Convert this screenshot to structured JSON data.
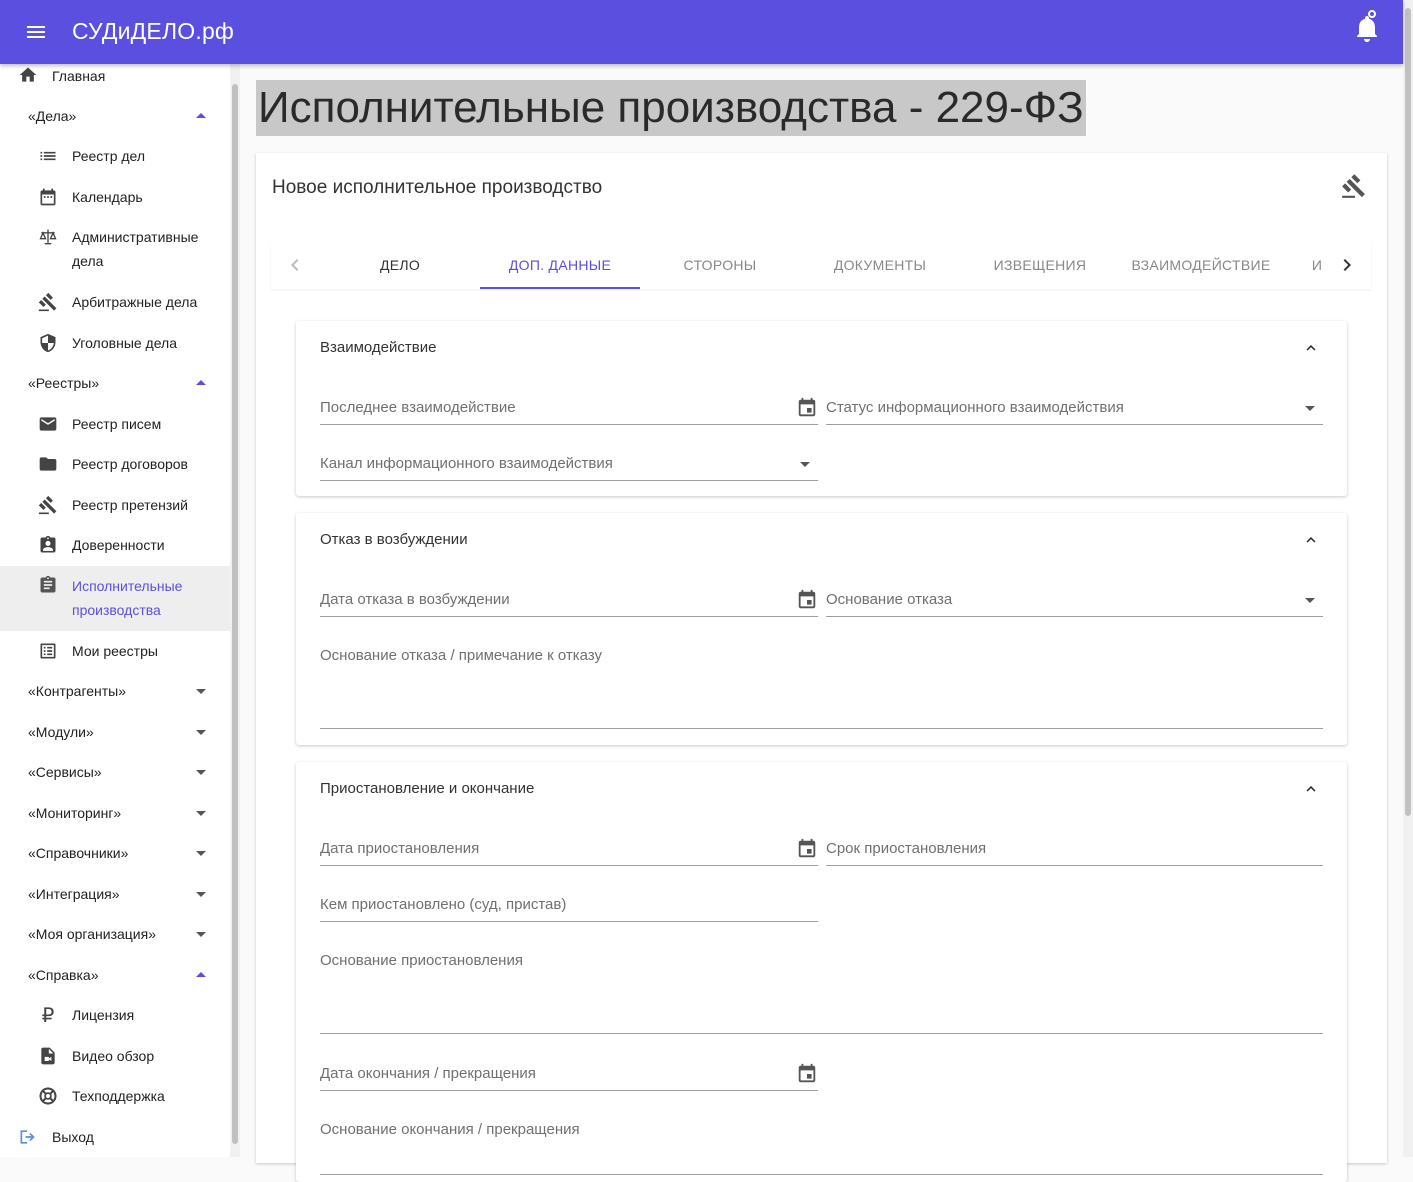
{
  "app": {
    "brand": "СУДиДЕЛО.рф"
  },
  "page": {
    "title": "Исполнительные производства - 229-ФЗ"
  },
  "sidebar": {
    "home": "Главная",
    "cases_section": "«Дела»",
    "cases": [
      "Реестр дел",
      "Календарь",
      "Административные дела",
      "Арбитражные дела",
      "Уголовные дела"
    ],
    "registries_section": "«Реестры»",
    "registries": [
      "Реестр писем",
      "Реестр договоров",
      "Реестр претензий",
      "Доверенности",
      "Исполнительные производства",
      "Мои реестры"
    ],
    "collapsed_sections": [
      "«Контрагенты»",
      "«Модули»",
      "«Сервисы»",
      "«Мониторинг»",
      "«Справочники»",
      "«Интеграция»",
      "«Моя организация»"
    ],
    "help_section": "«Справка»",
    "help": [
      "Лицензия",
      "Видео обзор",
      "Техподдержка"
    ],
    "logout": "Выход"
  },
  "card": {
    "title": "Новое исполнительное производство",
    "tabs": [
      "Дело",
      "Доп. данные",
      "Стороны",
      "Документы",
      "Извещения",
      "Взаимодействие",
      "И"
    ],
    "active_tab": "Доп. данные"
  },
  "panels": {
    "interaction": {
      "title": "Взаимодействие",
      "last_interaction": "Последнее взаимодействие",
      "info_status": "Статус информационного взаимодействия",
      "info_channel": "Канал информационного взаимодействия"
    },
    "refusal": {
      "title": "Отказ в возбуждении",
      "refusal_date": "Дата отказа в возбуждении",
      "refusal_reason": "Основание отказа",
      "refusal_note": "Основание отказа / примечание к отказу"
    },
    "suspension": {
      "title": "Приостановление и окончание",
      "suspension_date": "Дата приостановления",
      "suspension_term": "Срок приостановления",
      "suspended_by": "Кем приостановлено (суд, пристав)",
      "suspension_reason": "Основание приостановления",
      "end_date": "Дата окончания / прекращения",
      "end_reason": "Основание окончания / прекращения"
    }
  },
  "colors": {
    "accent": "#5a4fdf",
    "appbar": "#5a4fdf"
  }
}
